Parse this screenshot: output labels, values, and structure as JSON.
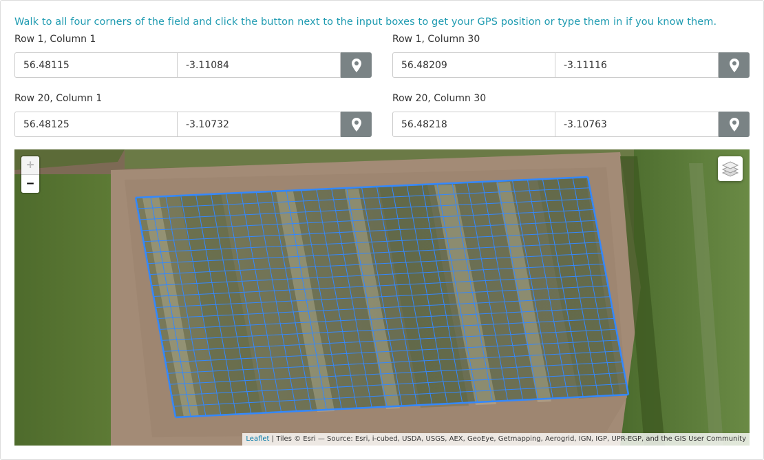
{
  "instructions": "Walk to all four corners of the field and click the button next to the input boxes to get your GPS position or type them in if you know them.",
  "corners": [
    {
      "label": "Row 1, Column 1",
      "lat": "56.48115",
      "lng": "-3.11084"
    },
    {
      "label": "Row 1, Column 30",
      "lat": "56.48209",
      "lng": "-3.11116"
    },
    {
      "label": "Row 20, Column 1",
      "lat": "56.48125",
      "lng": "-3.10732"
    },
    {
      "label": "Row 20, Column 30",
      "lat": "56.48218",
      "lng": "-3.10763"
    }
  ],
  "gps_button_icon": "map-marker-icon",
  "map": {
    "zoom_in": "+",
    "zoom_out": "−",
    "layers_icon": "layers-icon",
    "grid": {
      "rows": 20,
      "columns": 30,
      "line_color": "#3388ff"
    },
    "attribution": {
      "leaflet": "Leaflet",
      "separator": " | ",
      "text": "Tiles © Esri — Source: Esri, i-cubed, USDA, USGS, AEX, GeoEye, Getmapping, Aerogrid, IGN, IGP, UPR-EGP, and the GIS User Community"
    }
  },
  "colors": {
    "instructions": "#1f9bb1",
    "gps_button": "#7a8385"
  }
}
